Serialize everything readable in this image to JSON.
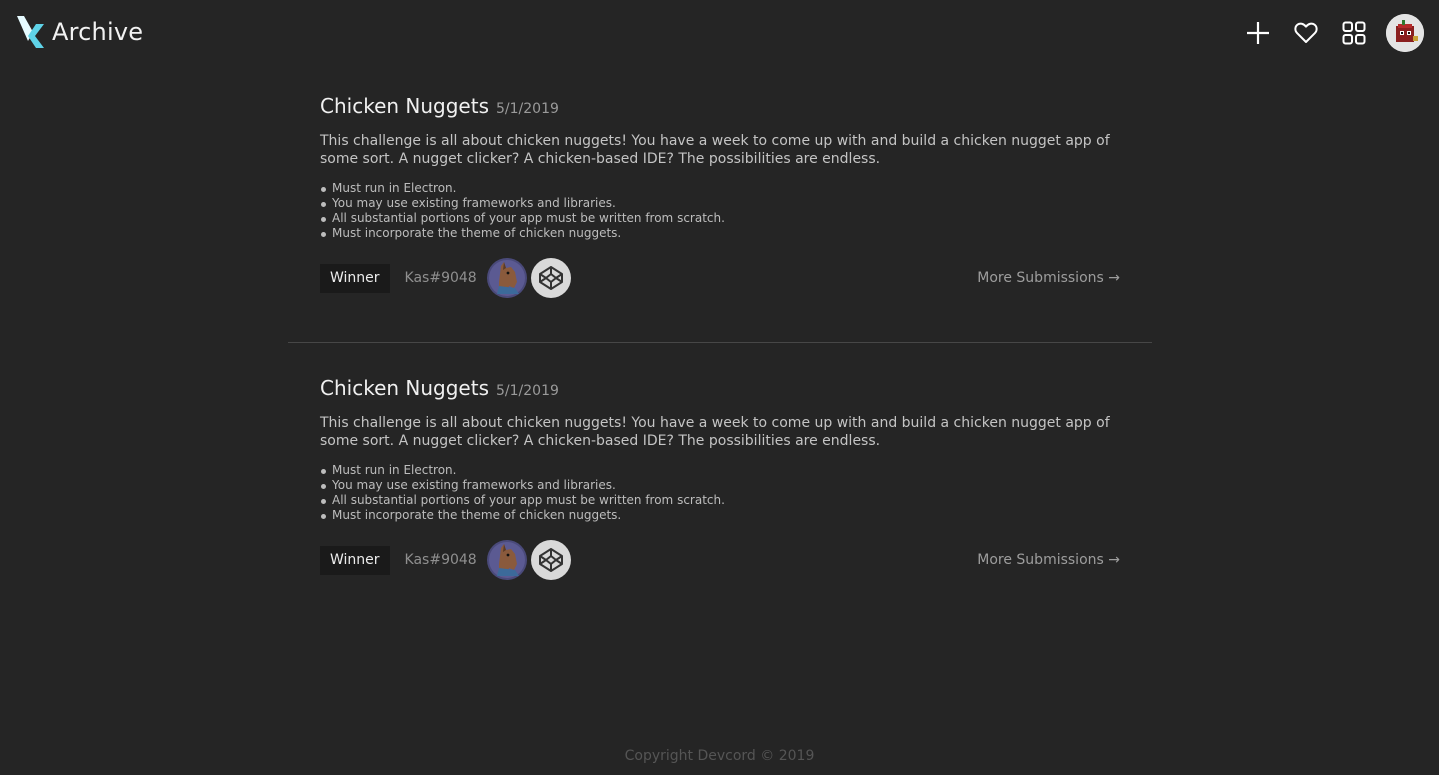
{
  "header": {
    "title": "Archive",
    "icons": [
      "logo-icon",
      "plus-icon",
      "heart-icon",
      "grid-icon",
      "user-avatar"
    ],
    "accent": "#5fd3e8"
  },
  "challenges": [
    {
      "title": "Chicken Nuggets",
      "date": "5/1/2019",
      "description": "This challenge is all about chicken nuggets! You have a week to come up with and build a chicken nugget app of some sort. A nugget clicker? A chicken-based IDE? The possibilities are endless.",
      "rules": [
        "Must run in Electron.",
        "You may use existing frameworks and libraries.",
        "All substantial portions of your app must be written from scratch.",
        "Must incorporate the theme of chicken nuggets."
      ],
      "winner_label": "Winner",
      "winner_name": "Kas#9048",
      "more_label": "More Submissions →"
    },
    {
      "title": "Chicken Nuggets",
      "date": "5/1/2019",
      "description": "This challenge is all about chicken nuggets! You have a week to come up with and build a chicken nugget app of some sort. A nugget clicker? A chicken-based IDE? The possibilities are endless.",
      "rules": [
        "Must run in Electron.",
        "You may use existing frameworks and libraries.",
        "All substantial portions of your app must be written from scratch.",
        "Must incorporate the theme of chicken nuggets."
      ],
      "winner_label": "Winner",
      "winner_name": "Kas#9048",
      "more_label": "More Submissions →"
    }
  ],
  "footer": {
    "copyright": "Copyright Devcord © 2019"
  }
}
